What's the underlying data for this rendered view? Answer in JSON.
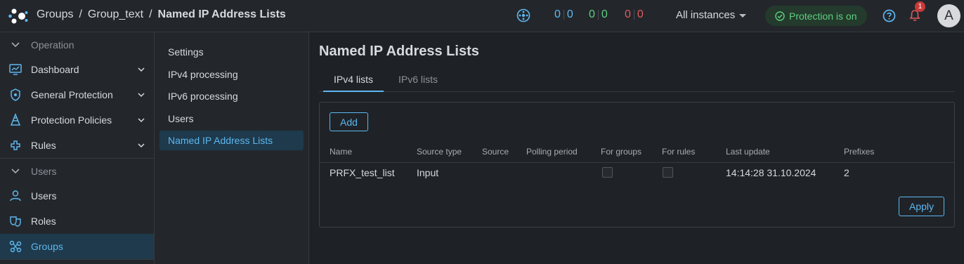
{
  "breadcrumb": {
    "items": [
      "Groups",
      "Group_text",
      "Named IP Address Lists"
    ],
    "separator": "/"
  },
  "counters": [
    {
      "a": "0",
      "b": "0",
      "color": "#5eb7f0"
    },
    {
      "a": "0",
      "b": "0",
      "color": "#5fd07e"
    },
    {
      "a": "0",
      "b": "0",
      "color": "#e0585b"
    }
  ],
  "instances": {
    "label": "All instances"
  },
  "protection": {
    "label": "Protection is on",
    "color": "#5fd07e"
  },
  "notifications": {
    "count": "1"
  },
  "user": {
    "initial": "A"
  },
  "sidebar": {
    "operation_label": "Operation",
    "dashboard_label": "Dashboard",
    "general_protection_label": "General Protection",
    "protection_policies_label": "Protection Policies",
    "rules_label": "Rules",
    "users_section_label": "Users",
    "users_label": "Users",
    "roles_label": "Roles",
    "groups_label": "Groups"
  },
  "subnav": {
    "settings": "Settings",
    "ipv4": "IPv4 processing",
    "ipv6": "IPv6 processing",
    "users": "Users",
    "named_lists": "Named IP Address Lists"
  },
  "main": {
    "title": "Named IP Address Lists",
    "tabs": {
      "ipv4": "IPv4 lists",
      "ipv6": "IPv6 lists"
    },
    "add_label": "Add",
    "apply_label": "Apply",
    "columns": {
      "name": "Name",
      "source_type": "Source type",
      "source": "Source",
      "polling": "Polling period",
      "for_groups": "For groups",
      "for_rules": "For rules",
      "last_update": "Last update",
      "prefixes": "Prefixes"
    },
    "rows": [
      {
        "name": "PRFX_test_list",
        "source_type": "Input",
        "source": "",
        "polling": "",
        "for_groups": false,
        "for_rules": false,
        "last_update": "14:14:28 31.10.2024",
        "prefixes": "2"
      }
    ]
  },
  "colors": {
    "accent": "#5eb7f0",
    "active_bg": "#1e3a4c",
    "danger": "#e0585b",
    "success": "#5fd07e"
  }
}
